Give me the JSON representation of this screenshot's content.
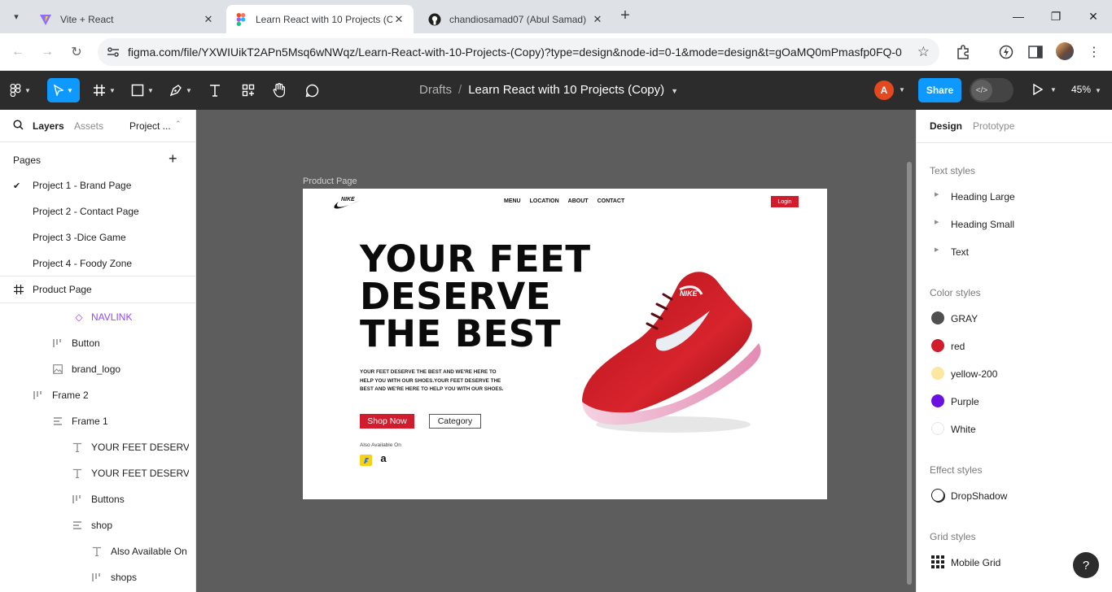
{
  "browser": {
    "tabs": [
      {
        "title": "Vite + React",
        "active": false
      },
      {
        "title": "Learn React with 10 Projects (Copy)",
        "active": true
      },
      {
        "title": "chandiosamad07 (Abul Samad)",
        "active": false
      }
    ],
    "url": "figma.com/file/YXWIUikT2APn5Msq6wNWqz/Learn-React-with-10-Projects-(Copy)?type=design&node-id=0-1&mode=design&t=gOaMQ0mPmasfp0FQ-0",
    "new_tab": "+",
    "window_controls": {
      "minimize": "—",
      "maximize": "❐",
      "close": "✕"
    }
  },
  "figma": {
    "breadcrumb": {
      "folder": "Drafts",
      "separator": "/",
      "file": "Learn React with 10 Projects (Copy)"
    },
    "avatar_initial": "A",
    "share_label": "Share",
    "zoom": "45%",
    "colors": {
      "accent": "#0d99ff",
      "toolbar": "#2c2c2c",
      "canvas": "#5d5d5d",
      "avatar": "#e4481f"
    }
  },
  "left_panel": {
    "tabs": {
      "layers": "Layers",
      "assets": "Assets",
      "page_switch": "Project ..."
    },
    "pages_heading": "Pages",
    "add_page": "+",
    "pages": [
      {
        "label": "Project 1 - Brand Page",
        "selected": true
      },
      {
        "label": "Project 2 - Contact Page",
        "selected": false
      },
      {
        "label": "Project 3 -Dice Game",
        "selected": false
      },
      {
        "label": "Project 4 - Foody Zone",
        "selected": false
      }
    ],
    "layers": [
      {
        "label": "Product Page",
        "icon": "frame-icon"
      },
      {
        "label": "NAVLINK",
        "icon": "component-instance-icon"
      },
      {
        "label": "Button",
        "icon": "auto-layout-horizontal-icon"
      },
      {
        "label": "brand_logo",
        "icon": "image-icon"
      },
      {
        "label": "Frame 2",
        "icon": "auto-layout-horizontal-icon"
      },
      {
        "label": "Frame 1",
        "icon": "auto-layout-vertical-icon"
      },
      {
        "label": "YOUR FEET DESERV...",
        "icon": "text-icon"
      },
      {
        "label": "YOUR FEET DESERV...",
        "icon": "text-icon"
      },
      {
        "label": "Buttons",
        "icon": "auto-layout-horizontal-icon"
      },
      {
        "label": "shop",
        "icon": "auto-layout-vertical-icon"
      },
      {
        "label": "Also Available On",
        "icon": "text-icon"
      },
      {
        "label": "shops",
        "icon": "auto-layout-horizontal-icon"
      }
    ]
  },
  "canvas": {
    "frame_label": "Product Page",
    "design": {
      "nav": [
        "MENU",
        "LOCATION",
        "ABOUT",
        "CONTACT"
      ],
      "login": "Login",
      "headline": [
        "YOUR FEET",
        "DESERVE",
        "THE BEST"
      ],
      "subtext": "YOUR FEET DESERVE THE BEST AND WE'RE HERE TO HELP YOU WITH OUR SHOES.YOUR FEET DESERVE THE BEST AND WE'RE HERE TO HELP YOU WITH OUR SHOES.",
      "shop_now": "Shop Now",
      "category": "Category",
      "also_available": "Also Available On",
      "amazon_glyph": "a",
      "brand_red": "#d01c2c"
    }
  },
  "right_panel": {
    "tabs": {
      "design": "Design",
      "prototype": "Prototype"
    },
    "text_styles_heading": "Text styles",
    "text_styles": [
      "Heading Large",
      "Heading Small",
      "Text"
    ],
    "color_styles_heading": "Color styles",
    "color_styles": [
      {
        "name": "GRAY",
        "color": "#505050"
      },
      {
        "name": "red",
        "color": "#d01c2c"
      },
      {
        "name": "yellow-200",
        "color": "#fbe6a2"
      },
      {
        "name": "Purple",
        "color": "#6a11e0"
      },
      {
        "name": "White",
        "color": "#ffffff"
      }
    ],
    "effect_styles_heading": "Effect styles",
    "effect_styles": [
      "DropShadow"
    ],
    "grid_styles_heading": "Grid styles",
    "grid_styles": [
      "Mobile Grid"
    ],
    "help": "?"
  }
}
